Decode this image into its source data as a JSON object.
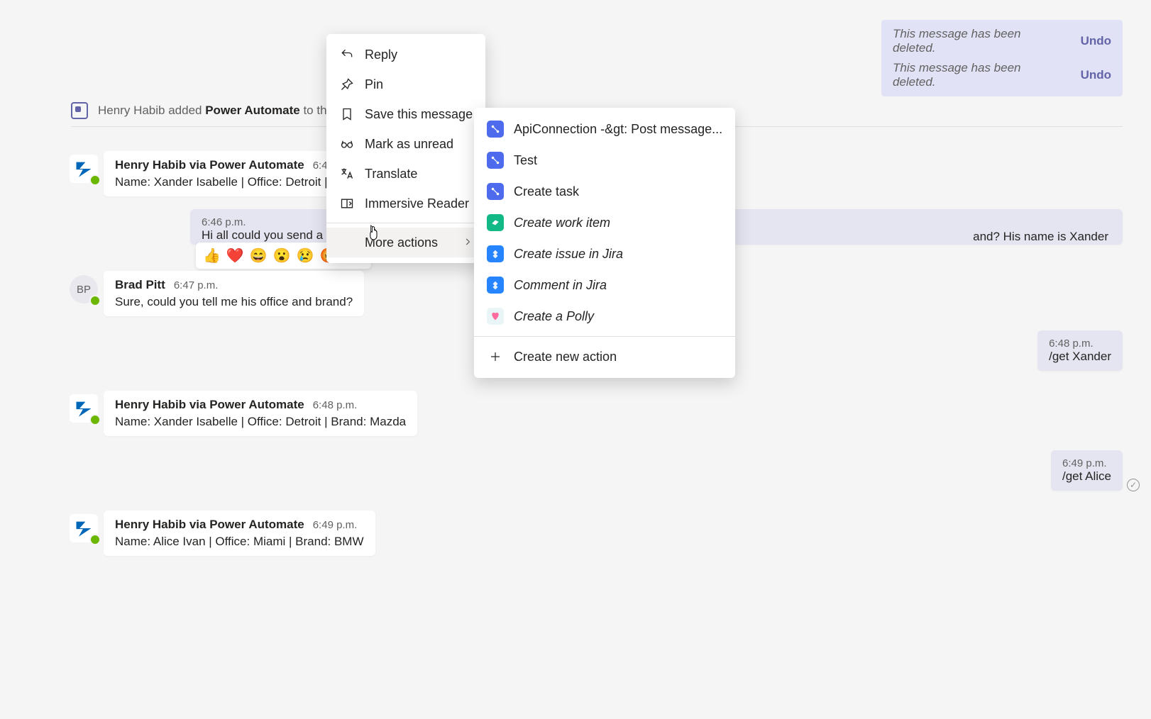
{
  "deleted": [
    {
      "text": "This message has been deleted.",
      "undo": "Undo"
    },
    {
      "text": "This message has been deleted.",
      "undo": "Undo"
    }
  ],
  "system": {
    "prefix": "Henry Habib added ",
    "app": "Power Automate",
    "suffix": " to the chat."
  },
  "messages": {
    "bot1": {
      "sender": "Henry Habib via Power Automate",
      "time": "6:45 p.m.",
      "body": "Name: Xander Isabelle | Office: Detroit | Br"
    },
    "mine1": {
      "time": "6:46 p.m.",
      "body": "Hi all  could you send a n",
      "tail": "and? His name is Xander"
    },
    "bp": {
      "sender": "Brad Pitt",
      "initials": "BP",
      "time": "6:47 p.m.",
      "body": "Sure, could you tell me his office and brand?"
    },
    "mine2": {
      "time": "6:48 p.m.",
      "body": "/get Xander"
    },
    "bot2": {
      "sender": "Henry Habib via Power Automate",
      "time": "6:48 p.m.",
      "body": "Name: Xander Isabelle | Office: Detroit | Brand: Mazda"
    },
    "mine3": {
      "time": "6:49 p.m.",
      "body": "/get Alice"
    },
    "bot3": {
      "sender": "Henry Habib via Power Automate",
      "time": "6:49 p.m.",
      "body": "Name: Alice Ivan | Office: Miami | Brand: BMW"
    }
  },
  "reactions": [
    "👍",
    "❤️",
    "😄",
    "😮",
    "😢",
    "😡"
  ],
  "context_menu": {
    "reply": "Reply",
    "pin": "Pin",
    "save": "Save this message",
    "unread": "Mark as unread",
    "translate": "Translate",
    "reader": "Immersive Reader",
    "more": "More actions"
  },
  "submenu": {
    "api": "ApiConnection -&gt: Post message...",
    "test": "Test",
    "task": "Create task",
    "workitem": "Create work item",
    "jira_issue": "Create issue in Jira",
    "jira_comment": "Comment in Jira",
    "polly": "Create a Polly",
    "new": "Create new action"
  }
}
